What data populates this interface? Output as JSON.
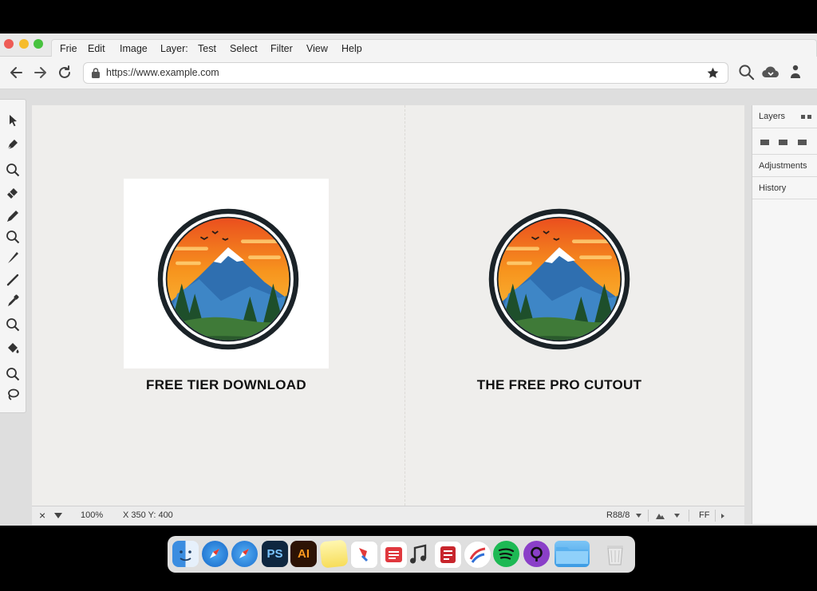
{
  "menu": {
    "items": [
      "Frie",
      "Edit",
      "Image",
      "Layer:",
      "Test",
      "Select",
      "Filter",
      "View",
      "Help"
    ]
  },
  "browser": {
    "url": "https://www.example.com"
  },
  "canvas": {
    "left_caption": "FREE TIER DOWNLOAD",
    "right_caption": "THE FREE PRO CUTOUT"
  },
  "status": {
    "close_label": "×",
    "zoom": "100%",
    "coords": "X 350 Y: 400",
    "color_mode": "R88/8",
    "ff_label": "FF"
  },
  "panels": {
    "layers": "Layers",
    "adjustments": "Adjustments",
    "history": "History"
  },
  "dock": {
    "ps_label": "PS",
    "ai_label": "AI"
  },
  "colors": {
    "accent_sky": "#f4a020",
    "mountain_blue": "#2f6fb0",
    "forest_green": "#2e6b34"
  }
}
